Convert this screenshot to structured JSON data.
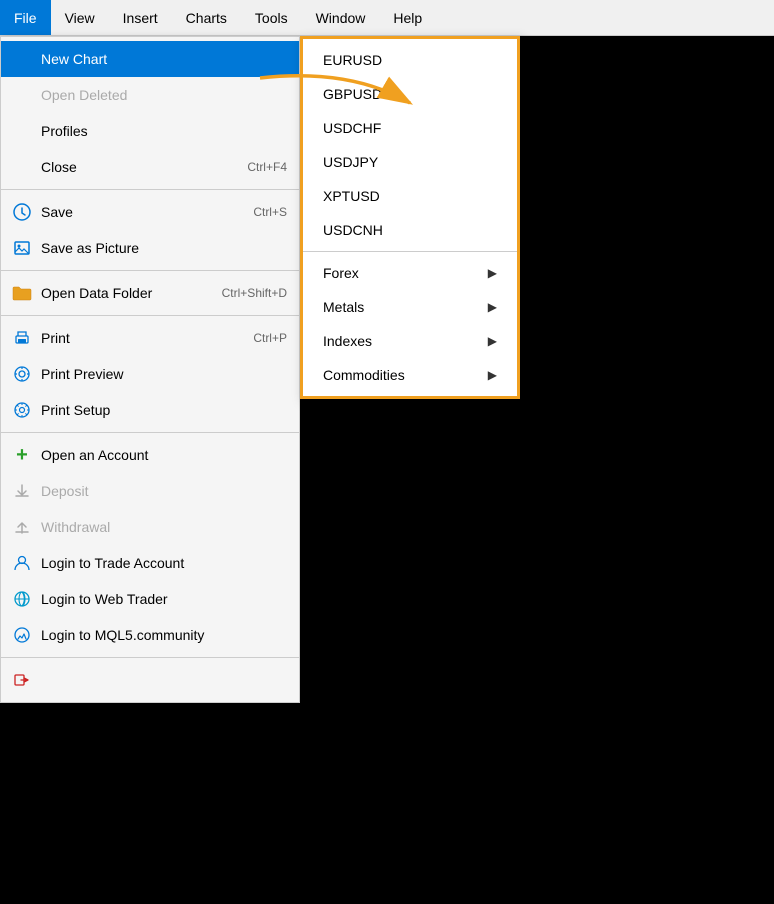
{
  "menubar": {
    "items": [
      {
        "label": "File",
        "active": true
      },
      {
        "label": "View",
        "active": false
      },
      {
        "label": "Insert",
        "active": false
      },
      {
        "label": "Charts",
        "active": false
      },
      {
        "label": "Tools",
        "active": false
      },
      {
        "label": "Window",
        "active": false
      },
      {
        "label": "Help",
        "active": false
      }
    ]
  },
  "mainMenu": {
    "items": [
      {
        "id": "new-chart",
        "icon": "",
        "label": "New Chart",
        "shortcut": "",
        "active": true,
        "disabled": false,
        "hasArrow": false
      },
      {
        "id": "open-deleted",
        "icon": "",
        "label": "Open Deleted",
        "shortcut": "",
        "active": false,
        "disabled": true,
        "hasArrow": false
      },
      {
        "id": "profiles",
        "icon": "",
        "label": "Profiles",
        "shortcut": "",
        "active": false,
        "disabled": false,
        "hasArrow": false
      },
      {
        "id": "close",
        "icon": "",
        "label": "Close",
        "shortcut": "Ctrl+F4",
        "active": false,
        "disabled": false,
        "hasArrow": false
      },
      {
        "id": "sep1",
        "type": "separator"
      },
      {
        "id": "save",
        "icon": "save",
        "label": "Save",
        "shortcut": "Ctrl+S",
        "active": false,
        "disabled": false,
        "hasArrow": false
      },
      {
        "id": "save-picture",
        "icon": "picture",
        "label": "Save as Picture",
        "shortcut": "",
        "active": false,
        "disabled": false,
        "hasArrow": false
      },
      {
        "id": "sep2",
        "type": "separator"
      },
      {
        "id": "open-data",
        "icon": "folder",
        "label": "Open Data Folder",
        "shortcut": "Ctrl+Shift+D",
        "active": false,
        "disabled": false,
        "hasArrow": false
      },
      {
        "id": "sep3",
        "type": "separator"
      },
      {
        "id": "print",
        "icon": "print",
        "label": "Print",
        "shortcut": "Ctrl+P",
        "active": false,
        "disabled": false,
        "hasArrow": false
      },
      {
        "id": "print-preview",
        "icon": "print-preview",
        "label": "Print Preview",
        "shortcut": "",
        "active": false,
        "disabled": false,
        "hasArrow": false
      },
      {
        "id": "print-setup",
        "icon": "print-setup",
        "label": "Print Setup",
        "shortcut": "",
        "active": false,
        "disabled": false,
        "hasArrow": false
      },
      {
        "id": "sep4",
        "type": "separator"
      },
      {
        "id": "open-account",
        "icon": "plus",
        "label": "Open an Account",
        "shortcut": "",
        "active": false,
        "disabled": false,
        "hasArrow": false
      },
      {
        "id": "deposit",
        "icon": "deposit",
        "label": "Deposit",
        "shortcut": "",
        "active": false,
        "disabled": true,
        "hasArrow": false
      },
      {
        "id": "withdrawal",
        "icon": "withdrawal",
        "label": "Withdrawal",
        "shortcut": "",
        "active": false,
        "disabled": true,
        "hasArrow": false
      },
      {
        "id": "login-trade",
        "icon": "user",
        "label": "Login to Trade Account",
        "shortcut": "",
        "active": false,
        "disabled": false,
        "hasArrow": false
      },
      {
        "id": "login-web",
        "icon": "globe",
        "label": "Login to Web Trader",
        "shortcut": "",
        "active": false,
        "disabled": false,
        "hasArrow": false
      },
      {
        "id": "login-mql5",
        "icon": "mql5",
        "label": "Login to MQL5.community",
        "shortcut": "",
        "active": false,
        "disabled": false,
        "hasArrow": false
      },
      {
        "id": "sep5",
        "type": "separator"
      },
      {
        "id": "exit",
        "icon": "exit",
        "label": "Exit",
        "shortcut": "",
        "active": false,
        "disabled": false,
        "hasArrow": false
      }
    ]
  },
  "subMenu": {
    "pairs": [
      {
        "id": "eurusd",
        "label": "EURUSD",
        "hasArrow": false
      },
      {
        "id": "gbpusd",
        "label": "GBPUSD",
        "hasArrow": false
      },
      {
        "id": "usdchf",
        "label": "USDCHF",
        "hasArrow": false
      },
      {
        "id": "usdjpy",
        "label": "USDJPY",
        "hasArrow": false
      },
      {
        "id": "xptusd",
        "label": "XPTUSD",
        "hasArrow": false
      },
      {
        "id": "usdcnh",
        "label": "USDCNH",
        "hasArrow": false
      }
    ],
    "categories": [
      {
        "id": "forex",
        "label": "Forex",
        "hasArrow": true
      },
      {
        "id": "metals",
        "label": "Metals",
        "hasArrow": true
      },
      {
        "id": "indexes",
        "label": "Indexes",
        "hasArrow": true
      },
      {
        "id": "commodities",
        "label": "Commodities",
        "hasArrow": true
      }
    ]
  }
}
